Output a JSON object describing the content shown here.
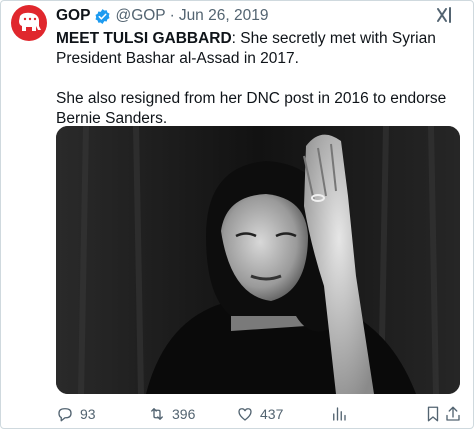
{
  "tweet": {
    "author_name": "GOP",
    "handle": "@GOP",
    "separator": "·",
    "date": "Jun 26, 2019",
    "lead_bold": "MEET TULSI GABBARD",
    "lead_rest": ": She secretly met with Syrian President Bashar al-Assad in 2017.",
    "paragraph2": "She also resigned from her DNC post in 2016 to endorse Bernie Sanders."
  },
  "actions": {
    "replies": "93",
    "retweets": "396",
    "likes": "437"
  },
  "icons": {
    "avatar": "gop-elephant-logo",
    "badge": "verified-badge-icon",
    "more": "grok-icon",
    "reply": "reply-icon",
    "retweet": "retweet-icon",
    "like": "heart-icon",
    "views": "views-chart-icon",
    "bookmark": "bookmark-icon",
    "share": "share-icon"
  },
  "colors": {
    "brand_red": "#e0272d",
    "verified_blue": "#1d9bf0",
    "muted_text": "#536471"
  }
}
